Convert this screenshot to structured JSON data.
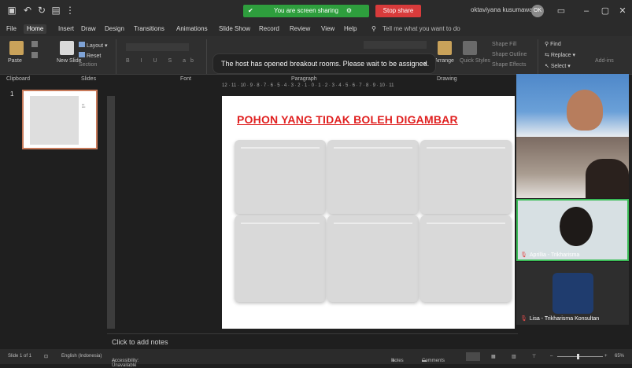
{
  "titlebar": {
    "share_text": "You are screen sharing",
    "share_icon1": "✔",
    "share_icon2": "⚙",
    "stop_share": "Stop share",
    "user": "oktaviyana kusumawati",
    "avatar_initials": "OK",
    "left_icons": [
      "save-icon",
      "undo-icon",
      "redo-icon",
      "present-icon",
      "more-icon"
    ]
  },
  "tabs": [
    "File",
    "Home",
    "Insert",
    "Draw",
    "Design",
    "Transitions",
    "Animations",
    "Slide Show",
    "Record",
    "Review",
    "View",
    "Help"
  ],
  "tell_me": "Tell me what you want to do",
  "ribbon": {
    "paste": "Paste",
    "new_slide": "New Slide",
    "layout": "Layout",
    "reset": "Reset",
    "section": "Section",
    "arrange": "Arrange",
    "quick_styles": "Quick Styles",
    "shape_fill": "Shape Fill",
    "shape_outline": "Shape Outline",
    "shape_effects": "Shape Effects",
    "find": "Find",
    "replace": "Replace",
    "select": "Select",
    "add_ins": "Add-ins",
    "groups": {
      "clipboard": "Clipboard",
      "slides": "Slides",
      "font": "Font",
      "paragraph": "Paragraph",
      "drawing": "Drawing"
    }
  },
  "toast": {
    "message": "The host has opened breakout rooms. Please wait to be assigned.",
    "close": "×"
  },
  "ruler_top": "12 · 11 · 10 · 9 · 8 · 7 · 6 · 5 · 4 · 3 · 2 · 1 · 0 · 1 · 2 · 3 · 4 · 5 · 6 · 7 · 8 · 9 · 10 · 11",
  "slide": {
    "number": "1",
    "title": "POHON YANG TIDAK BOLEH DIGAMBAR"
  },
  "notes_placeholder": "Click to add notes",
  "status": {
    "slide_of": "Slide 1 of 1",
    "language": "English (Indonesia)",
    "accessibility": "Accessibility: Unavailable",
    "notes": "Notes",
    "comments": "Comments",
    "zoom": "65%"
  },
  "participants": [
    {
      "name": ""
    },
    {
      "name": ""
    },
    {
      "name": "Aprillia - Trikharisma"
    },
    {
      "name": "Lisa - Trikharisma Konsultan"
    }
  ]
}
